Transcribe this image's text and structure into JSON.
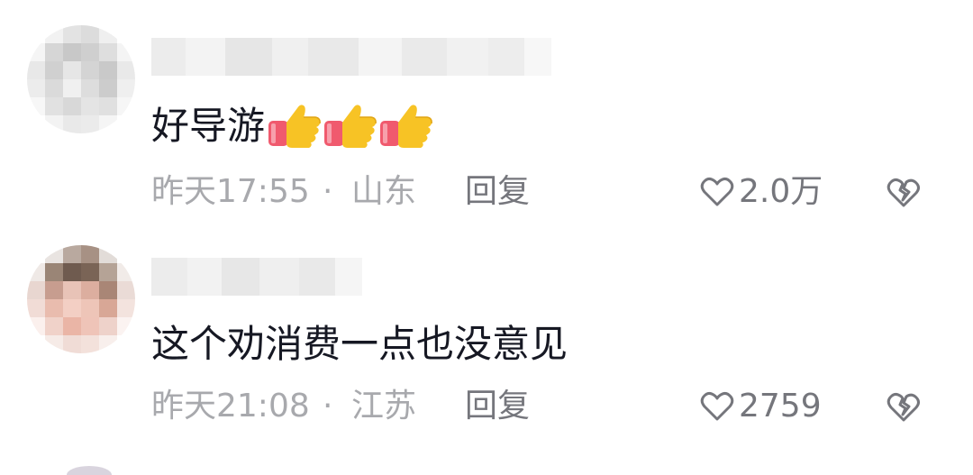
{
  "comments": [
    {
      "text": "好导游",
      "emoji_count": 3,
      "emoji_icon": "thumbs-up-icon",
      "time": "昨天17:55",
      "separator": "·",
      "location": "山东",
      "reply_label": "回复",
      "likes": "2.0万"
    },
    {
      "text": "这个劝消费一点也没意见",
      "time": "昨天21:08",
      "separator": "·",
      "location": "江苏",
      "reply_label": "回复",
      "likes": "2759"
    }
  ],
  "colors": {
    "meta_text": "#a8a9ad",
    "action_text": "#75767c",
    "body_text": "#161823",
    "thumb_yellow": "#f7c325",
    "cuff_red": "#f05a6e"
  }
}
